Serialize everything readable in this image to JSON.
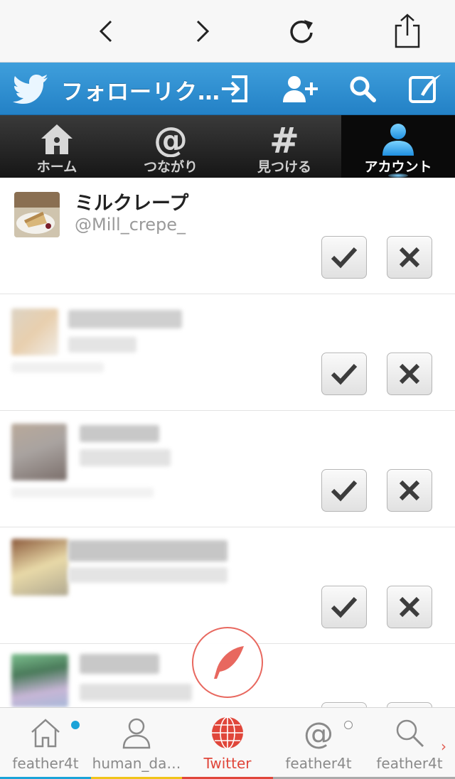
{
  "browser": {
    "back_icon": "chevron-left-icon",
    "forward_icon": "chevron-right-icon",
    "reload_icon": "reload-icon",
    "share_icon": "share-icon"
  },
  "header": {
    "title": "フォローリク…",
    "brand_color": "#2f8fd5"
  },
  "tabs": [
    {
      "label": "ホーム",
      "icon": "home-icon",
      "active": false
    },
    {
      "label": "つながり",
      "icon": "at-icon",
      "active": false
    },
    {
      "label": "見つける",
      "icon": "hash-icon",
      "active": false
    },
    {
      "label": "アカウント",
      "icon": "person-icon",
      "active": true
    }
  ],
  "requests": [
    {
      "name": "ミルクレープ",
      "handle": "@Mill_crepe_",
      "blurred": false
    },
    {
      "name": "",
      "handle": "",
      "blurred": true
    },
    {
      "name": "",
      "handle": "",
      "blurred": true
    },
    {
      "name": "",
      "handle": "",
      "blurred": true
    },
    {
      "name": "",
      "handle": "",
      "blurred": true
    }
  ],
  "bottom_accounts": [
    {
      "label": "feather4t",
      "icon": "home-icon",
      "underline": "#1aa3d8"
    },
    {
      "label": "human_da…",
      "icon": "person-icon",
      "underline": "#f0c419"
    },
    {
      "label": "Twitter",
      "icon": "globe-icon",
      "underline": "#e0463a",
      "active": true
    },
    {
      "label": "feather4t",
      "icon": "at-icon",
      "underline": "#aaaaaa"
    },
    {
      "label": "feather4t",
      "icon": "search-icon",
      "underline": "#aaaaaa"
    }
  ],
  "accent_color": "#e0463a"
}
